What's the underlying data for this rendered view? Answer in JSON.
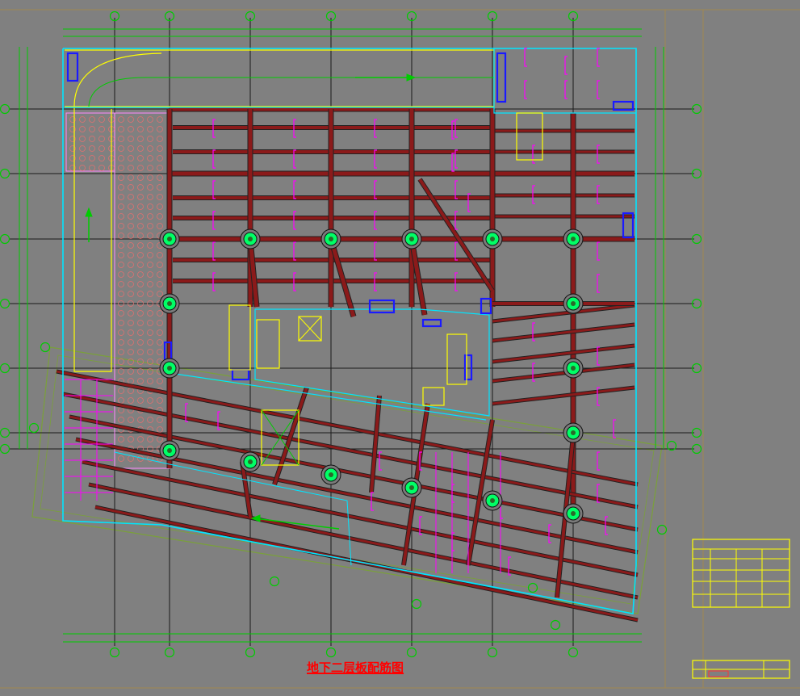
{
  "drawing": {
    "title": "地下二层板配筋图"
  },
  "colors": {
    "background": "#808080",
    "frame": "#a08850",
    "axis": "#00cc00",
    "wall": "#00e5ff",
    "beam_fill": "#8b1a1a",
    "beam_edge": "#222222",
    "rebar": "#ff00ff",
    "outline": "#ffff00",
    "column": "#00ff66",
    "opening": "#1a1aff",
    "ramp": "#ff88ff",
    "title_text": "#ff0000",
    "title_block": "#ffff00",
    "boundary": "#7aa03a"
  },
  "icons": {
    "ramp_arrow": "arrow-icon",
    "axis_bubble": "axis-bubble-icon"
  }
}
